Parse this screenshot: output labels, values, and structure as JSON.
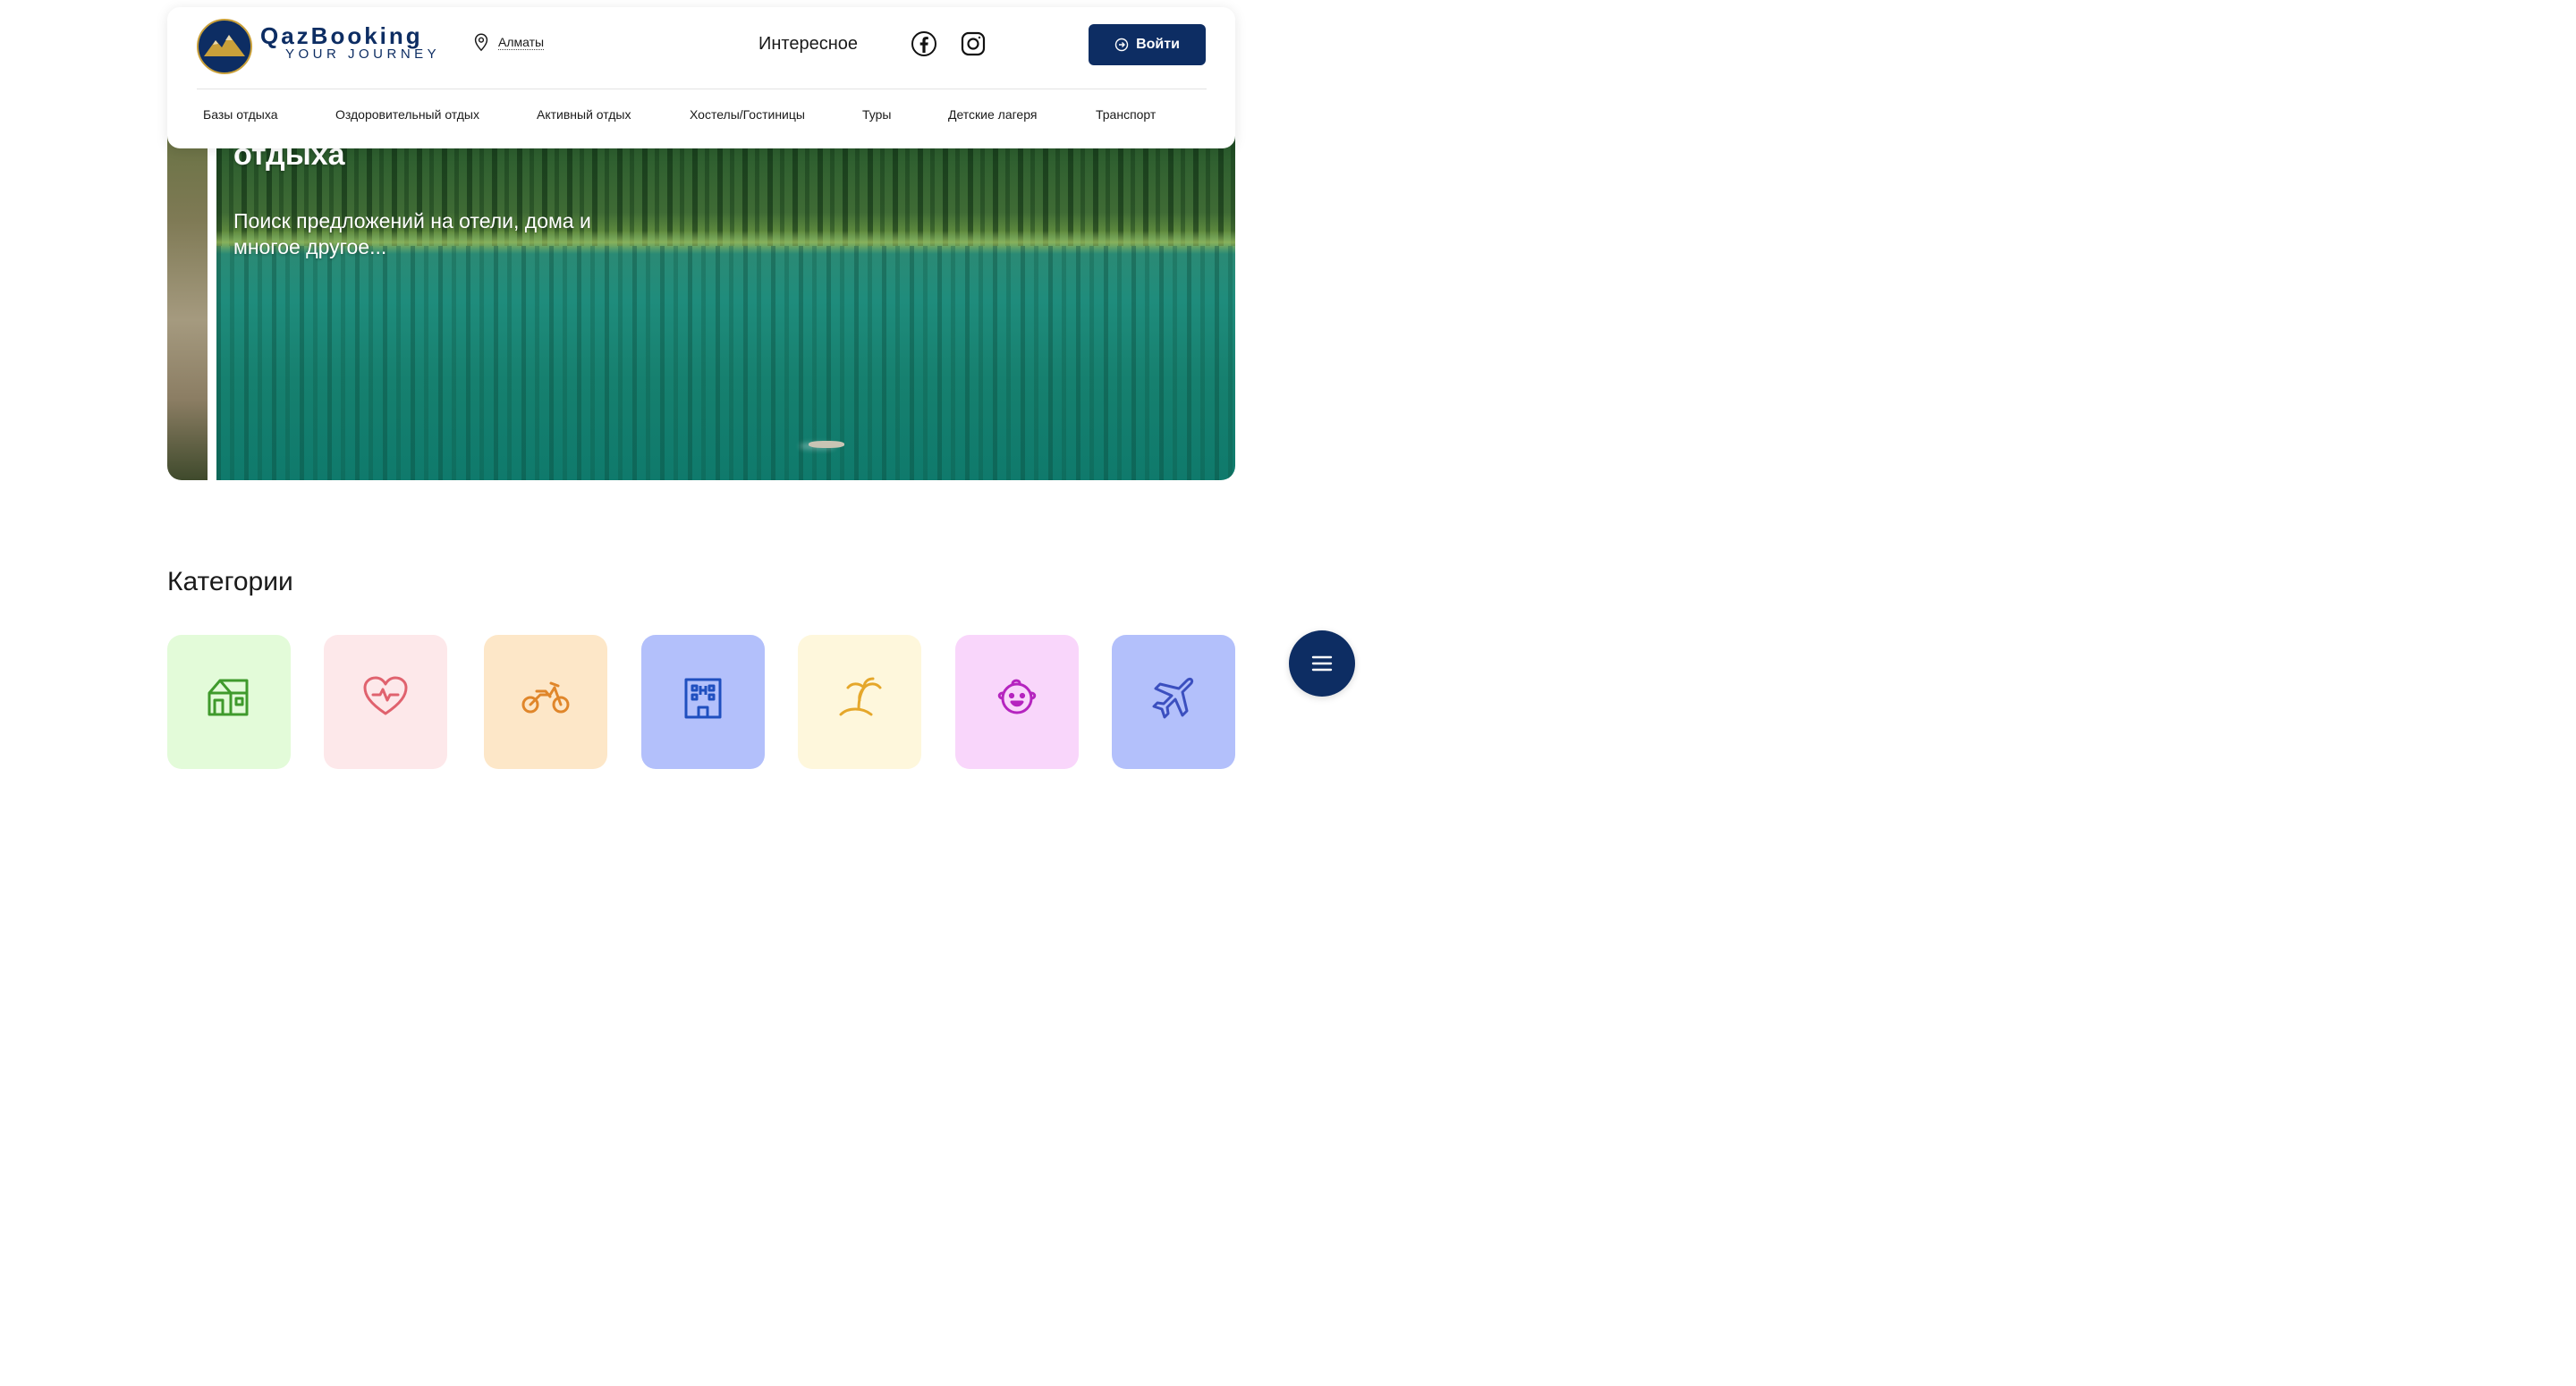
{
  "header": {
    "logo": {
      "name": "QazBooking",
      "tagline": "YOUR JOURNEY",
      "icon": "mountain-logo-icon"
    },
    "location": {
      "label": "Алматы",
      "icon": "location-pin-icon"
    },
    "interesting_label": "Интересное",
    "social": [
      {
        "name": "facebook",
        "icon": "facebook-icon"
      },
      {
        "name": "instagram",
        "icon": "instagram-icon"
      }
    ],
    "login_label": "Войти",
    "nav": [
      {
        "label": "Базы отдыха"
      },
      {
        "label": "Оздоровительный отдых"
      },
      {
        "label": "Активный отдых"
      },
      {
        "label": "Хостелы/Гостиницы"
      },
      {
        "label": "Туры"
      },
      {
        "label": "Детские лагеря"
      },
      {
        "label": "Транспорт"
      }
    ]
  },
  "hero": {
    "title": "отдыха",
    "subtitle": "Поиск предложений на отели, дома и многое другое..."
  },
  "categories": {
    "title": "Категории",
    "items": [
      {
        "icon": "house-icon",
        "bg": "#e3fbd9",
        "color": "#3f9a2c"
      },
      {
        "icon": "heart-pulse-icon",
        "bg": "#fde8ea",
        "color": "#e0626e"
      },
      {
        "icon": "motorbike-icon",
        "bg": "#fde7c8",
        "color": "#e0862a"
      },
      {
        "icon": "building-icon",
        "bg": "#b3c0fb",
        "color": "#1f4fbf"
      },
      {
        "icon": "palm-island-icon",
        "bg": "#fef7dc",
        "color": "#e5a72a"
      },
      {
        "icon": "baby-face-icon",
        "bg": "#f9d6fb",
        "color": "#b524bf"
      },
      {
        "icon": "airplane-icon",
        "bg": "#b3c0fb",
        "color": "#3b4fbf"
      }
    ]
  },
  "colors": {
    "brand": "#0d2d63",
    "gold": "#c9a03a"
  }
}
